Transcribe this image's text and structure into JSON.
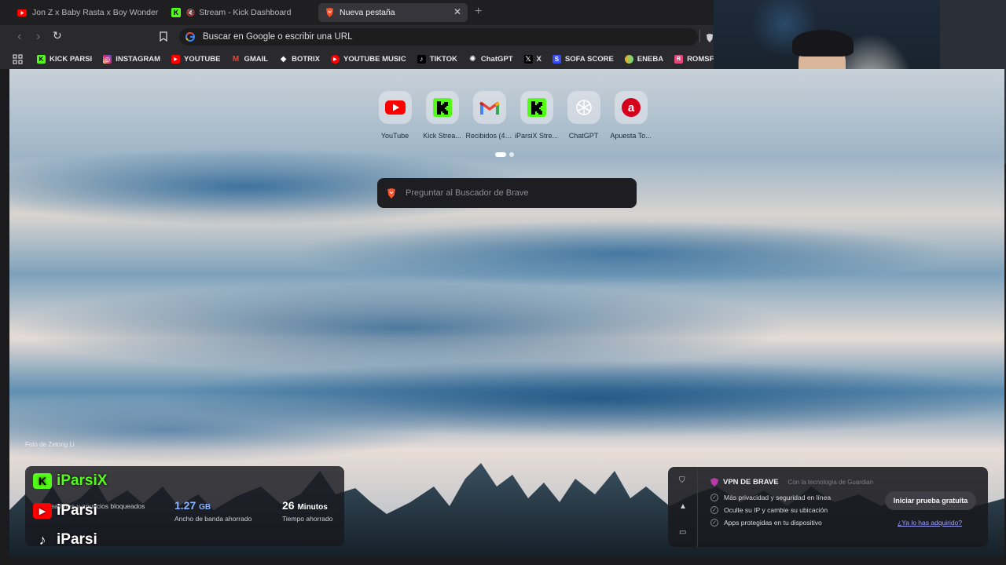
{
  "tabs": [
    {
      "title": "Jon Z x Baby Rasta x Boy Wonder CF",
      "icon": "youtube-icon"
    },
    {
      "title": "Stream - Kick Dashboard",
      "icon": "kick-icon",
      "muted": true
    },
    {
      "title": "Nueva pestaña",
      "icon": "brave-icon",
      "active": true
    }
  ],
  "toolbar": {
    "omnibox_placeholder": "Buscar en Google o escribir una URL"
  },
  "bookmarks": [
    {
      "label": "KICK PARSI",
      "icon": "kick-icon",
      "color": "#53fc18"
    },
    {
      "label": "INSTAGRAM",
      "icon": "instagram-icon",
      "color": "#e1306c"
    },
    {
      "label": "YOUTUBE",
      "icon": "youtube-icon",
      "color": "#ff0000"
    },
    {
      "label": "GMAIL",
      "icon": "gmail-icon",
      "color": "#ea4335"
    },
    {
      "label": "BOTRIX",
      "icon": "botrix-icon",
      "color": "#ffffff"
    },
    {
      "label": "YOUTUBE MUSIC",
      "icon": "youtube-music-icon",
      "color": "#ff0000"
    },
    {
      "label": "TIKTOK",
      "icon": "tiktok-icon",
      "color": "#000000"
    },
    {
      "label": "ChatGPT",
      "icon": "chatgpt-icon",
      "color": "#74aa9c"
    },
    {
      "label": "X",
      "icon": "x-icon",
      "color": "#000000"
    },
    {
      "label": "SOFA SCORE",
      "icon": "sofascore-icon",
      "color": "#374df5"
    },
    {
      "label": "ENEBA",
      "icon": "eneba-icon",
      "color": "#f5a623"
    },
    {
      "label": "ROMSFUN",
      "icon": "romsfun-icon",
      "color": "#e04a7a"
    }
  ],
  "topsites": [
    {
      "label": "YouTube",
      "icon": "youtube-icon"
    },
    {
      "label": "Kick Strea...",
      "icon": "kick-icon"
    },
    {
      "label": "Recibidos (4)...",
      "icon": "gmail-icon"
    },
    {
      "label": "iParsiX Stre...",
      "icon": "kick-icon"
    },
    {
      "label": "ChatGPT",
      "icon": "chatgpt-icon"
    },
    {
      "label": "Apuesta To...",
      "icon": "apuesta-icon"
    }
  ],
  "search": {
    "placeholder": "Preguntar al Buscador de Brave"
  },
  "photo_credit": "Foto de Zetong Li",
  "stats": [
    {
      "value": "",
      "unit": "",
      "desc": "Rastreadores y anuncios bloqueados"
    },
    {
      "value": "1.27",
      "unit": "GB",
      "desc": "Ancho de banda ahorrado"
    },
    {
      "value": "26",
      "unit": "Minutos",
      "desc": "Tiempo ahorrado"
    }
  ],
  "overlay": [
    {
      "label": "iParsiX",
      "icon": "kick-icon"
    },
    {
      "label": "iParsi",
      "icon": "youtube-icon"
    },
    {
      "label": "iParsi",
      "icon": "tiktok-icon"
    }
  ],
  "vpn": {
    "title": "VPN DE BRAVE",
    "powered_by": "Con la tecnología de Guardian",
    "features": [
      "Más privacidad y seguridad en línea",
      "Oculte su IP y cambie su ubicación",
      "Apps protegidas en tu dispositivo"
    ],
    "cta": "Iniciar prueba gratuita",
    "link": "¿Ya lo has adquirido?"
  },
  "colors": {
    "kick_green": "#53fc18",
    "brave_orange": "#fb542b",
    "link_purple": "#9ea3ff"
  }
}
